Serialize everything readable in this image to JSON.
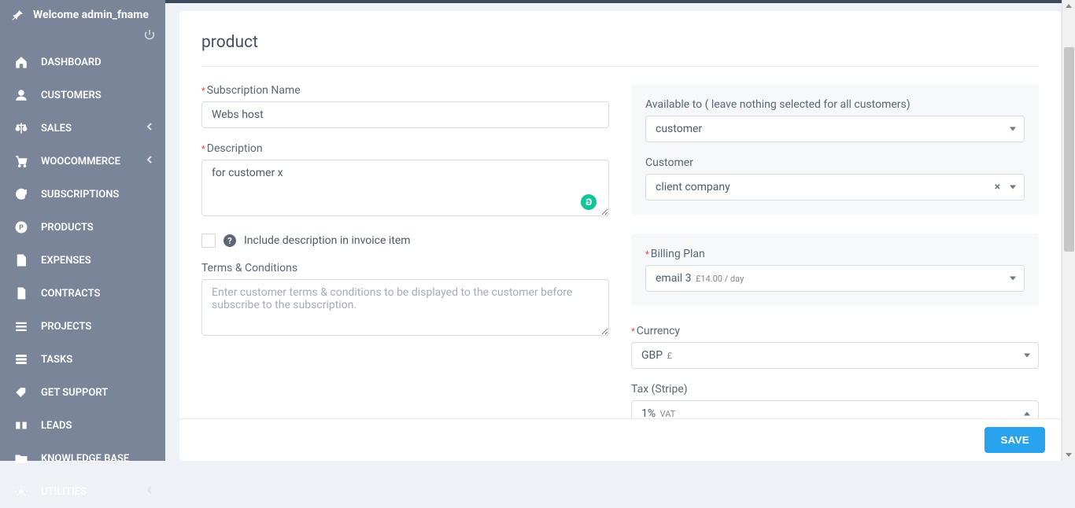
{
  "sidebar": {
    "welcome_label": "Welcome admin_fname",
    "items": [
      {
        "label": "DASHBOARD",
        "icon": "home",
        "submenu": false
      },
      {
        "label": "CUSTOMERS",
        "icon": "user",
        "submenu": false
      },
      {
        "label": "SALES",
        "icon": "scales",
        "submenu": true
      },
      {
        "label": "WOOCOMMERCE",
        "icon": "cart",
        "submenu": true
      },
      {
        "label": "SUBSCRIPTIONS",
        "icon": "refresh",
        "submenu": false
      },
      {
        "label": "PRODUCTS",
        "icon": "p-circle",
        "submenu": false
      },
      {
        "label": "EXPENSES",
        "icon": "file",
        "submenu": false
      },
      {
        "label": "CONTRACTS",
        "icon": "page",
        "submenu": false
      },
      {
        "label": "PROJECTS",
        "icon": "bars",
        "submenu": false
      },
      {
        "label": "TASKS",
        "icon": "tasks",
        "submenu": false
      },
      {
        "label": "GET SUPPORT",
        "icon": "tag",
        "submenu": false
      },
      {
        "label": "LEADS",
        "icon": "leads",
        "submenu": false
      },
      {
        "label": "KNOWLEDGE BASE",
        "icon": "folder",
        "submenu": false
      },
      {
        "label": "UTILITIES",
        "icon": "gear",
        "submenu": true
      }
    ]
  },
  "page": {
    "title": "product",
    "labels": {
      "subscription_name": "Subscription Name",
      "description": "Description",
      "include_desc": "Include description in invoice item",
      "terms": "Terms & Conditions",
      "terms_placeholder": "Enter customer terms & conditions to be displayed to the customer before subscribe to the subscription.",
      "available_to": "Available to ( leave nothing selected for all customers)",
      "customer": "Customer",
      "billing_plan": "Billing Plan",
      "currency": "Currency",
      "tax_stripe": "Tax (Stripe)"
    },
    "values": {
      "subscription_name": "Webs host",
      "description": "for customer x",
      "available_to": "customer",
      "customer": "client company",
      "billing_plan": "email 3",
      "billing_plan_suffix": "£14.00 / day",
      "currency": "GBP",
      "currency_symbol": "£",
      "tax_value": "1%",
      "tax_suffix": "VAT"
    }
  },
  "footer": {
    "save_label": "SAVE"
  },
  "colors": {
    "accent": "#2aa3ef",
    "sidebar": "#7a8599"
  }
}
